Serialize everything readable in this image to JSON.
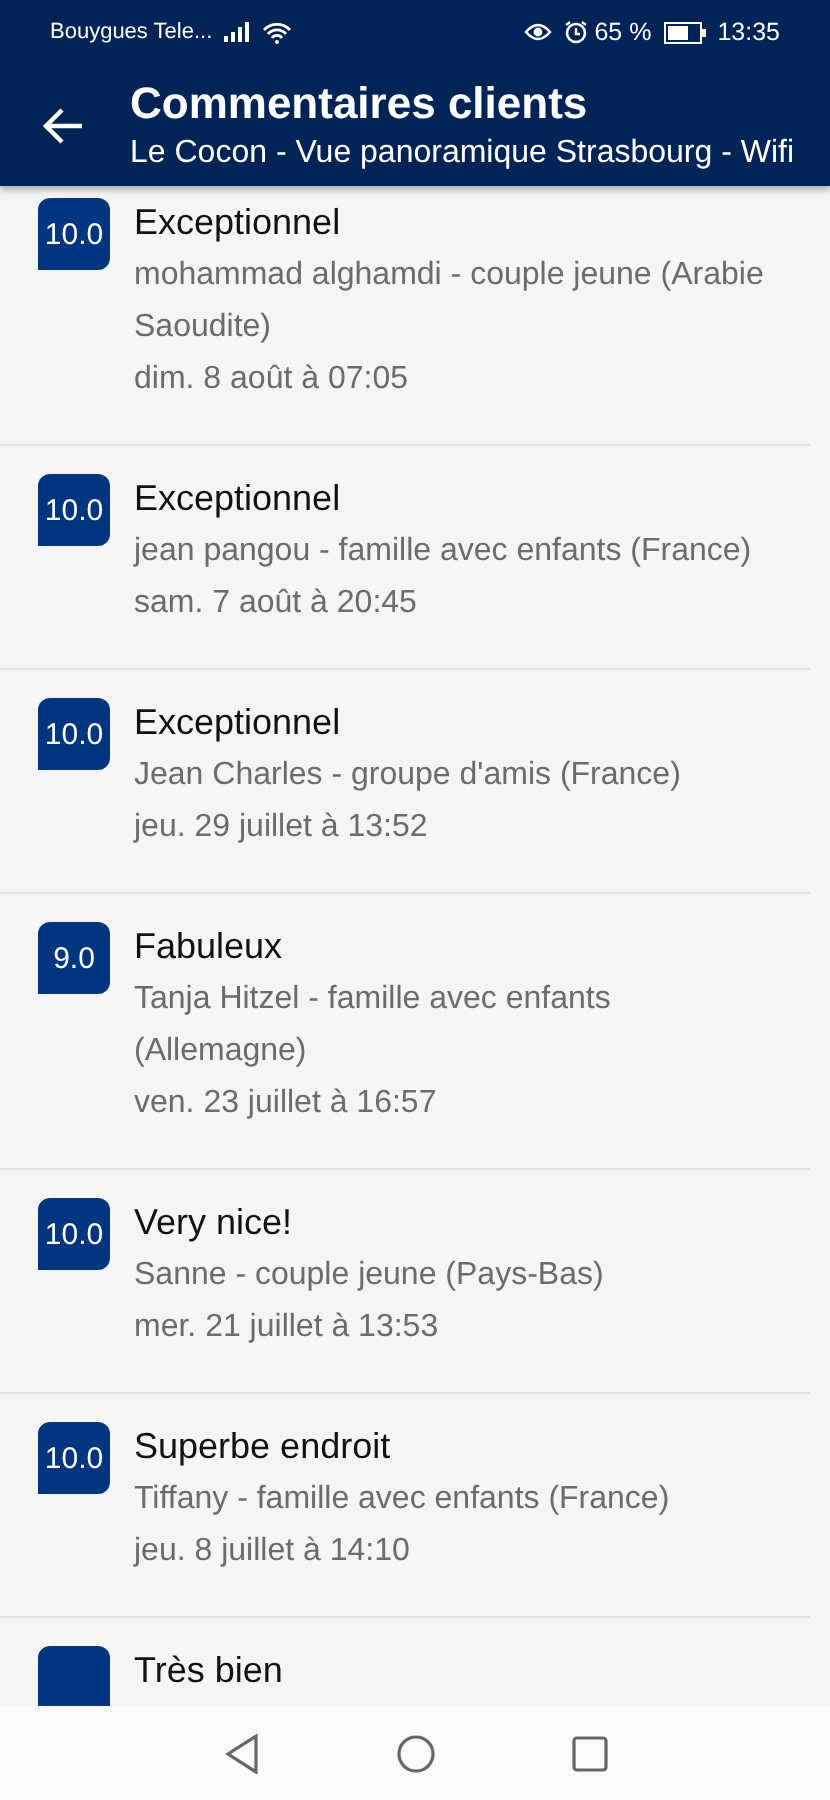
{
  "status_bar": {
    "carrier": "Bouygues Tele...",
    "battery_text": "65 %",
    "time": "13:35"
  },
  "header": {
    "title": "Commentaires clients",
    "subtitle": "Le Cocon - Vue panoramique Strasbourg - Wifi"
  },
  "reviews": [
    {
      "score": "10.0",
      "title": "Exceptionnel",
      "author": "mohammad alghamdi - couple jeune (Arabie Saoudite)",
      "date": "dim. 8 août à 07:05"
    },
    {
      "score": "10.0",
      "title": "Exceptionnel",
      "author": "jean pangou - famille avec enfants (France)",
      "date": "sam. 7 août à 20:45"
    },
    {
      "score": "10.0",
      "title": "Exceptionnel",
      "author": "Jean Charles - groupe d'amis (France)",
      "date": "jeu. 29 juillet à 13:52"
    },
    {
      "score": "9.0",
      "title": "Fabuleux",
      "author": "Tanja Hitzel - famille avec enfants (Allemagne)",
      "date": "ven. 23 juillet à 16:57"
    },
    {
      "score": "10.0",
      "title": "Very nice!",
      "author": "Sanne - couple jeune (Pays-Bas)",
      "date": "mer. 21 juillet à 13:53"
    },
    {
      "score": "10.0",
      "title": "Superbe endroit",
      "author": "Tiffany - famille avec enfants (France)",
      "date": "jeu. 8 juillet à 14:10"
    },
    {
      "title": "Très bien"
    }
  ]
}
